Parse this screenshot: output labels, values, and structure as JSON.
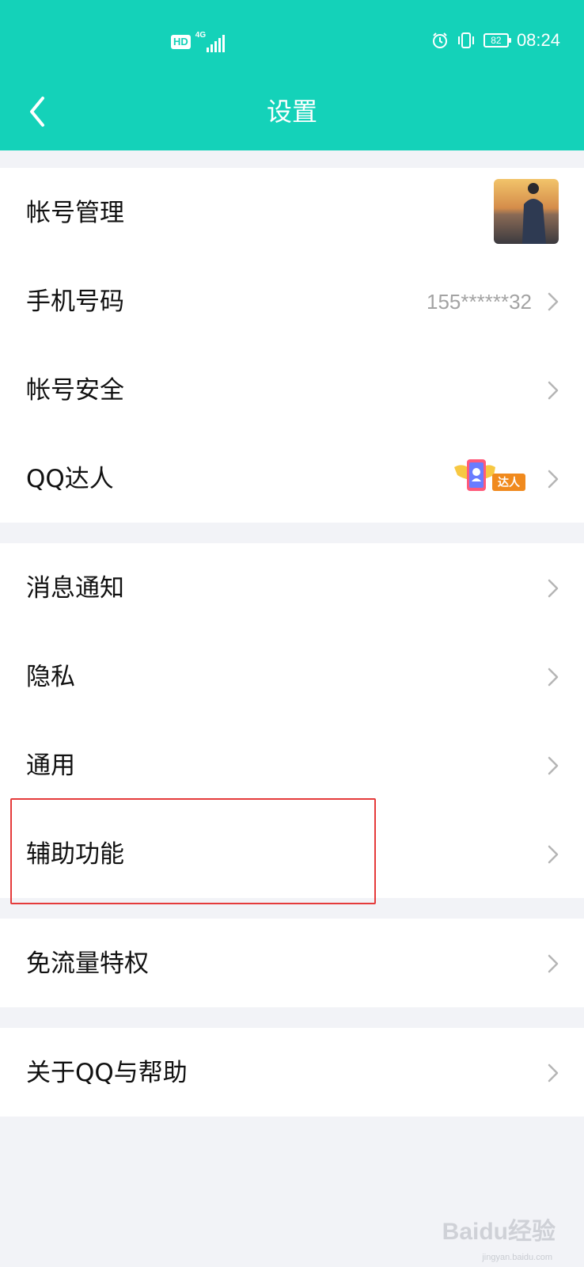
{
  "status_bar": {
    "hd_badge": "HD",
    "network_type": "4G",
    "battery_level": "82",
    "time": "08:24",
    "icons": [
      "hd-icon",
      "signal-icon",
      "alarm-icon",
      "vibrate-icon",
      "battery-icon"
    ]
  },
  "nav": {
    "back_icon": "chevron-left-icon",
    "title": "设置"
  },
  "settings": {
    "group1": [
      {
        "label": "帐号管理",
        "trailing": "avatar-thumbnail"
      },
      {
        "label": "手机号码",
        "value": "155******32"
      },
      {
        "label": "帐号安全"
      },
      {
        "label": "QQ达人",
        "badge_text": "达人"
      }
    ],
    "group2": [
      {
        "label": "消息通知"
      },
      {
        "label": "隐私"
      },
      {
        "label": "通用"
      },
      {
        "label": "辅助功能",
        "highlighted": true
      }
    ],
    "group3": [
      {
        "label": "免流量特权"
      }
    ],
    "group4": [
      {
        "label": "关于QQ与帮助"
      }
    ]
  },
  "highlight_color": "#e53b3b",
  "accent_color": "#14d2b9",
  "watermark": {
    "text": "Baidu经验",
    "sub": "jingyan.baidu.com"
  }
}
